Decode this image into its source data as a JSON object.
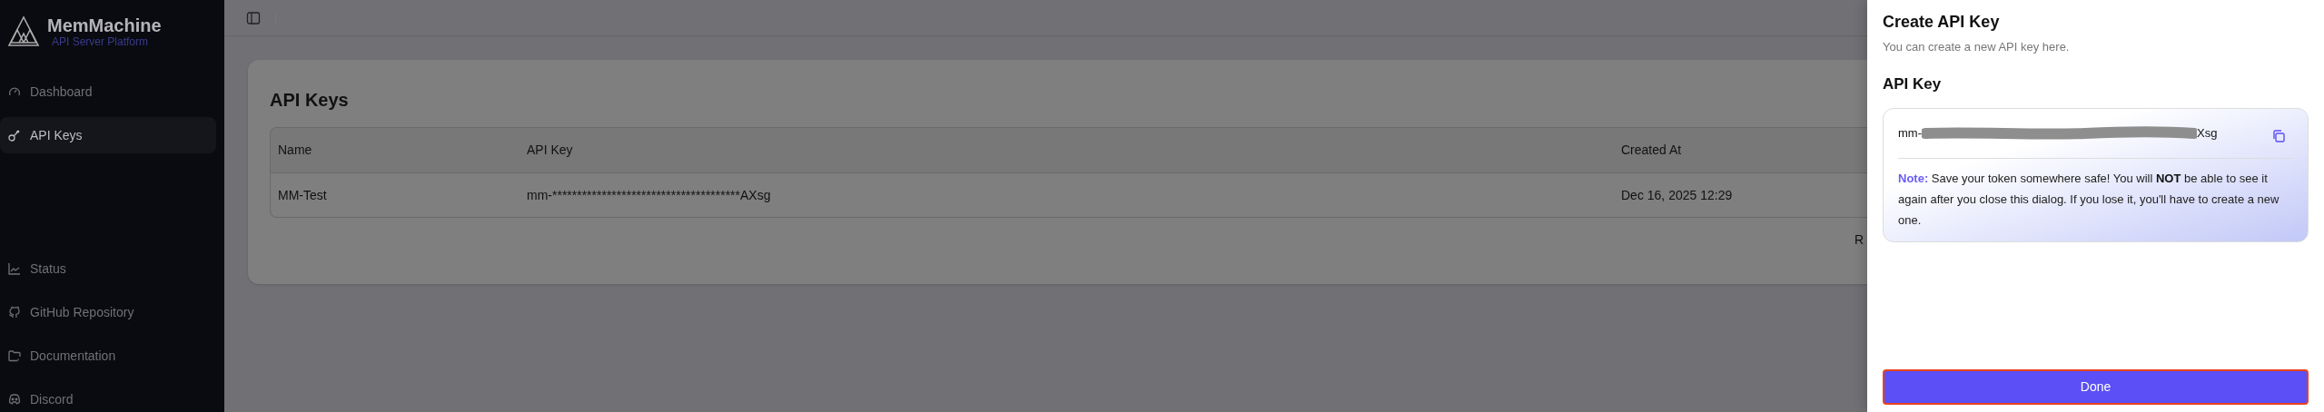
{
  "sidebar": {
    "logo": {
      "title": "MemMachine",
      "subtitle": "API Server Platform"
    },
    "items": [
      {
        "label": "Dashboard",
        "selected": false
      },
      {
        "label": "API Keys",
        "selected": true
      }
    ],
    "footer_items": [
      {
        "label": "Status"
      },
      {
        "label": "GitHub Repository"
      },
      {
        "label": "Documentation"
      },
      {
        "label": "Discord"
      }
    ]
  },
  "main": {
    "title": "API Keys",
    "table": {
      "columns": [
        "Name",
        "API Key",
        "Created At"
      ],
      "rows": [
        [
          "MM-Test",
          "mm-**************************************AXsg",
          "Dec 16, 2025 12:29"
        ]
      ]
    },
    "footer_button": "R"
  },
  "panel": {
    "title": "Create API Key",
    "description": "You can create a new API key here.",
    "key_heading": "API Key",
    "key": {
      "prefix": "mm-",
      "suffix": "Xsg"
    },
    "note": "**Note:** Save your token somewhere safe! You will **NOT** be able to see it again after you close this dialog. If you lose it, you'll have to create a new one.",
    "done": {
      "label": "Done",
      "focused": true
    }
  }
}
